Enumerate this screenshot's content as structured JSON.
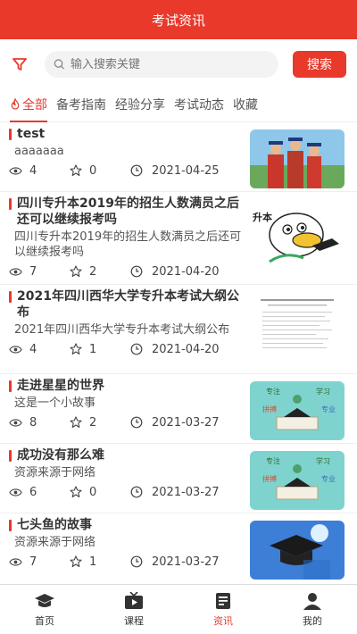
{
  "header": {
    "title": "考试资讯"
  },
  "search": {
    "placeholder": "输入搜索关键",
    "button": "搜索"
  },
  "tabs": [
    {
      "label": "全部"
    },
    {
      "label": "备考指南"
    },
    {
      "label": "经验分享"
    },
    {
      "label": "考试动态"
    },
    {
      "label": "收藏"
    }
  ],
  "articles": [
    {
      "title": "test",
      "desc": "aaaaaaa",
      "views": "4",
      "favorites": "0",
      "date": "2021-04-25"
    },
    {
      "title": "四川专升本2019年的招生人数满员之后还可以继续报考吗",
      "desc": "四川专升本2019年的招生人数满员之后还可以继续报考吗",
      "views": "7",
      "favorites": "2",
      "date": "2021-04-20"
    },
    {
      "title": "2021年四川西华大学专升本考试大纲公布",
      "desc": "2021年四川西华大学专升本考试大纲公布",
      "views": "4",
      "favorites": "1",
      "date": "2021-04-20"
    },
    {
      "title": "走进星星的世界",
      "desc": "这是一个小故事",
      "views": "8",
      "favorites": "2",
      "date": "2021-03-27"
    },
    {
      "title": "成功没有那么难",
      "desc": "资源来源于网络",
      "views": "6",
      "favorites": "0",
      "date": "2021-03-27"
    },
    {
      "title": "七头鱼的故事",
      "desc": "资源来源于网络",
      "views": "7",
      "favorites": "1",
      "date": "2021-03-27"
    }
  ],
  "thumb_text": {
    "duck": "升本",
    "card_a": "专注",
    "card_b": "学习",
    "card_c": "拼搏",
    "card_d": "专业"
  },
  "nav": [
    {
      "label": "首页"
    },
    {
      "label": "课程"
    },
    {
      "label": "资讯"
    },
    {
      "label": "我的"
    }
  ],
  "colors": {
    "accent": "#e8392b"
  }
}
